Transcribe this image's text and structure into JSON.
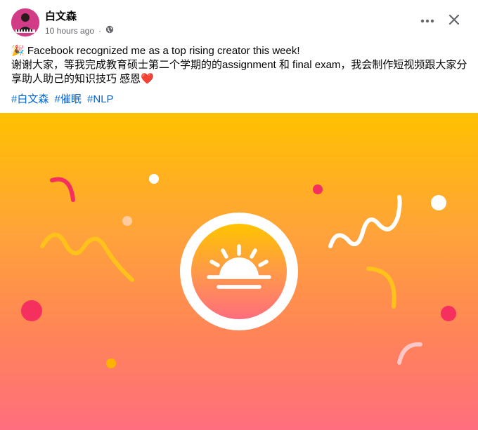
{
  "post": {
    "author_name": "白文森",
    "timestamp": "10 hours ago",
    "audience_icon": "globe-icon",
    "more_icon": "more-options-icon",
    "close_icon": "close-icon",
    "line1": "🎉 Facebook recognized me as a top rising creator this week!",
    "line2": "谢谢大家，等我完成教育硕士第二个学期的的assignment 和 final exam，我会制作短视频跟大家分享助人助己的知识技巧 感恩❤️",
    "hashtags": [
      "#白文森",
      "#催眠",
      "#NLP"
    ]
  },
  "banner": {
    "badge_icon": "rising-sun-icon",
    "colors": {
      "top": "#ffc100",
      "bottom": "#ff6e7e",
      "accent_red": "#f5305f",
      "accent_yellow": "#ffc21a",
      "white": "#ffffff"
    }
  }
}
